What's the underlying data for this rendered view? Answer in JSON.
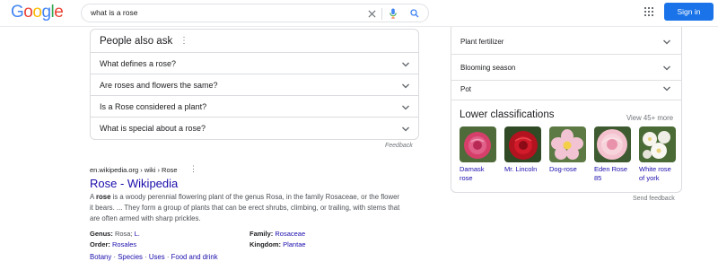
{
  "header": {
    "logo_letters": [
      "G",
      "o",
      "o",
      "g",
      "l",
      "e"
    ],
    "logo_colors": [
      "#4285f4",
      "#ea4335",
      "#fbbc05",
      "#4285f4",
      "#34a853",
      "#ea4335"
    ],
    "query": "what is a rose",
    "signin_label": "Sign in"
  },
  "paa": {
    "title": "People also ask",
    "questions": [
      "What defines a rose?",
      "Are roses and flowers the same?",
      "Is a Rose considered a plant?",
      "What is special about a rose?"
    ],
    "feedback": "Feedback"
  },
  "result": {
    "cite": "en.wikipedia.org › wiki › Rose",
    "title": "Rose - Wikipedia",
    "snippet_bold": "rose",
    "snippet_pre": "A ",
    "snippet_post": " is a woody perennial flowering plant of the genus Rosa, in the family Rosaceae, or the flower it bears. ... They form a group of plants that can be erect shrubs, climbing, or trailing, with stems that are often armed with sharp prickles.",
    "facts": {
      "genus_label": "Genus:",
      "genus_value_plain": "Rosa;",
      "genus_value_link": "L.",
      "family_label": "Family:",
      "family_value": "Rosaceae",
      "order_label": "Order:",
      "order_value": "Rosales",
      "kingdom_label": "Kingdom:",
      "kingdom_value": "Plantae"
    },
    "sitelinks": [
      "Botany",
      "Species",
      "Uses",
      "Food and drink"
    ]
  },
  "knowledge_panel": {
    "rows": [
      "Plant fertilizer",
      "Blooming season",
      "Pot"
    ],
    "lower_title": "Lower classifications",
    "view_more": "View 45+ more",
    "classifications": [
      {
        "line1": "Damask",
        "line2": "rose",
        "color": "#d63f6a"
      },
      {
        "line1": "Mr. Lincoln",
        "line2": "",
        "color": "#b3121f"
      },
      {
        "line1": "Dog-rose",
        "line2": "",
        "color": "#e8a9bd"
      },
      {
        "line1": "Eden Rose",
        "line2": "85",
        "color": "#f2b6c6"
      },
      {
        "line1": "White rose",
        "line2": "of york",
        "color": "#f4f2ea"
      }
    ],
    "send_feedback": "Send feedback"
  },
  "colors": {
    "link": "#1a0dab",
    "accent": "#1a73e8",
    "border": "#dadce0"
  }
}
